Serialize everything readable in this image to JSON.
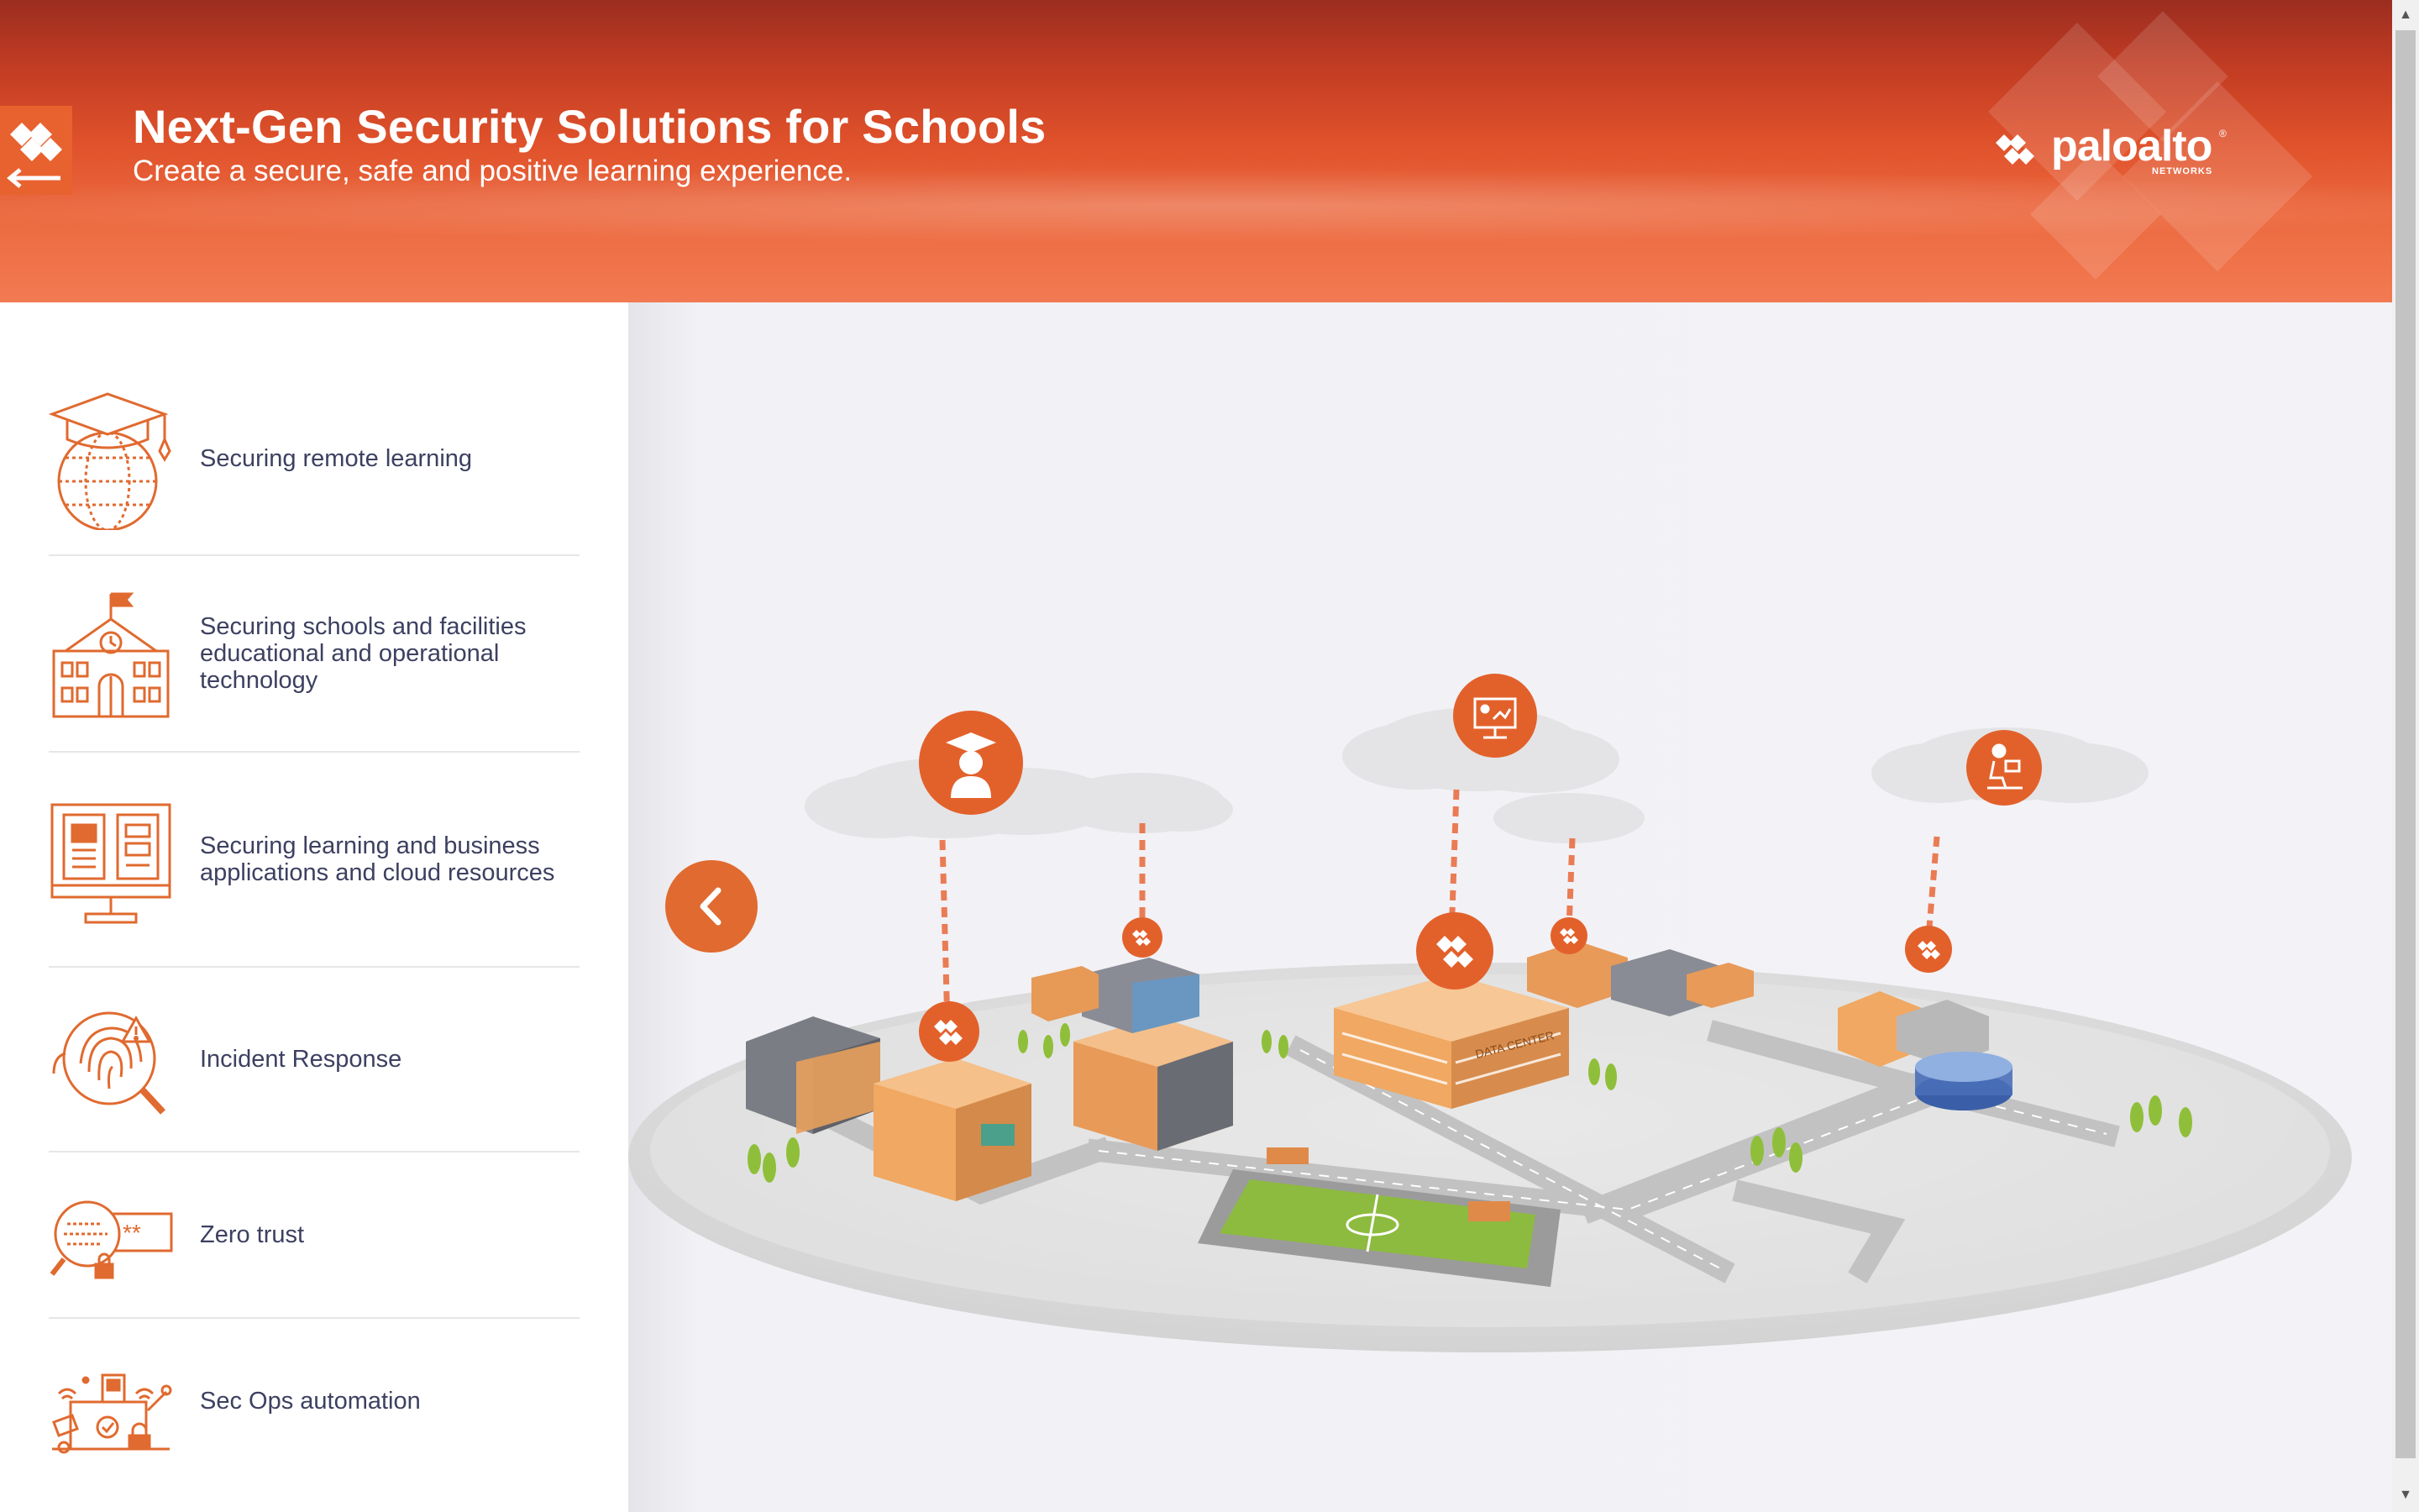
{
  "header": {
    "title": "Next-Gen Security Solutions for Schools",
    "subtitle": "Create a secure, safe and positive learning experience.",
    "brand": "paloalto",
    "brand_sub": "NETWORKS",
    "brand_mark": "®"
  },
  "sidebar": {
    "items": [
      {
        "label": "Securing remote learning",
        "icon": "graduation-globe-icon"
      },
      {
        "label": "Securing schools and facilities educational and operational technology",
        "icon": "school-building-icon"
      },
      {
        "label": "Securing learning and business applications and cloud resources",
        "icon": "monitor-book-icon"
      },
      {
        "label": "Incident Response",
        "icon": "fingerprint-search-icon"
      },
      {
        "label": "Zero trust",
        "icon": "password-search-icon"
      },
      {
        "label": "Sec Ops automation",
        "icon": "automation-devices-icon"
      }
    ]
  },
  "map": {
    "hotspots": [
      {
        "icon": "student-icon"
      },
      {
        "icon": "teacher-presentation-icon"
      },
      {
        "icon": "remote-worker-icon"
      }
    ],
    "nodes": [
      {
        "icon": "firewall-node-icon"
      },
      {
        "icon": "firewall-node-icon"
      },
      {
        "icon": "firewall-node-icon"
      },
      {
        "icon": "firewall-node-icon"
      },
      {
        "icon": "firewall-node-icon"
      }
    ],
    "data_center_sign": "DATA CENTER"
  },
  "colors": {
    "accent": "#e06a2f",
    "header_dark": "#9b2d20",
    "header_light": "#f27a52",
    "label_text": "#3d4060",
    "map_bg": "#f3f2f6"
  }
}
